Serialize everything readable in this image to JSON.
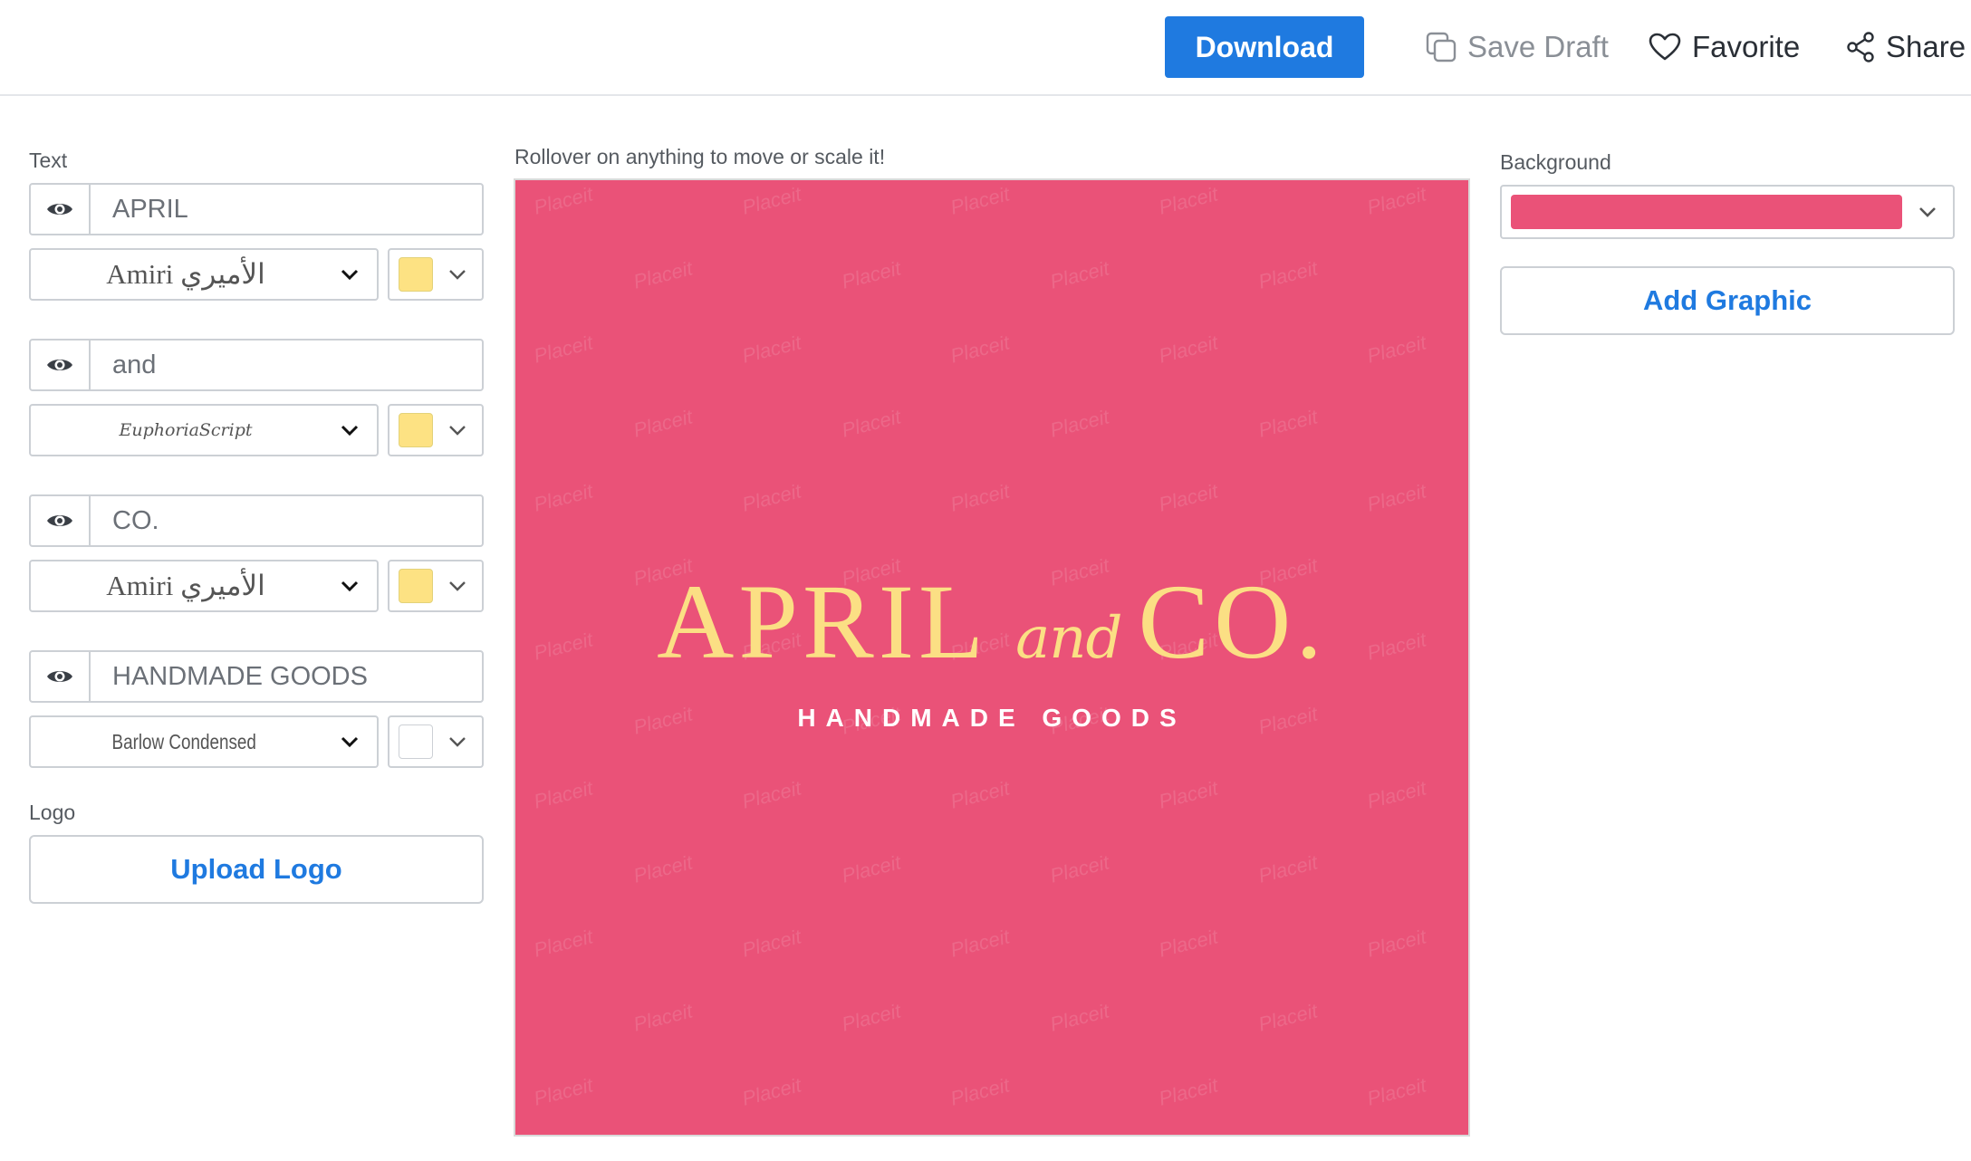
{
  "toolbar": {
    "download_label": "Download",
    "save_draft_label": "Save Draft",
    "favorite_label": "Favorite",
    "share_label": "Share"
  },
  "left_panel": {
    "text_section_label": "Text",
    "layers": [
      {
        "text": "APRIL",
        "font": "Amiri الأميري",
        "font_style": "amiri",
        "color": "#fde283",
        "icon": "eye-icon"
      },
      {
        "text": "and",
        "font": "EuphoriaScript",
        "font_style": "euphoria",
        "color": "#fde283",
        "icon": "eye-icon"
      },
      {
        "text": "CO.",
        "font": "Amiri الأميري",
        "font_style": "amiri",
        "color": "#fde283",
        "icon": "eye-icon"
      },
      {
        "text": "HANDMADE GOODS",
        "font": "Barlow Condensed",
        "font_style": "barlow",
        "color": "#ffffff",
        "icon": "eye-icon"
      }
    ],
    "logo_section_label": "Logo",
    "upload_logo_label": "Upload Logo"
  },
  "canvas": {
    "hint": "Rollover on anything to move or scale it!",
    "background_color": "#ea5278",
    "watermark_text": "Placeit",
    "logo_text_1": "APRIL",
    "logo_text_2": "and",
    "logo_text_3": "CO.",
    "logo_tagline": "HANDMADE GOODS"
  },
  "right_panel": {
    "background_label": "Background",
    "background_color": "#ea5278",
    "add_graphic_label": "Add Graphic"
  },
  "colors": {
    "accent": "#1f7ae0",
    "text_yellow": "#fde283",
    "canvas_pink": "#ea5278"
  }
}
